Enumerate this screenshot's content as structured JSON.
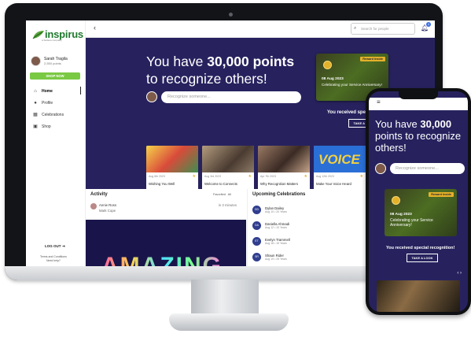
{
  "brand": {
    "name": "inspirus",
    "tagline": "a Sodexo company"
  },
  "user": {
    "name": "Sarah Tragila",
    "points": "2,550 points"
  },
  "sidebar": {
    "shop_button": "SHOP NOW",
    "items": [
      {
        "label": "Home",
        "icon": "home-icon"
      },
      {
        "label": "Profile",
        "icon": "person-icon"
      },
      {
        "label": "Celebrations",
        "icon": "calendar-icon"
      },
      {
        "label": "Shop",
        "icon": "bag-icon"
      }
    ],
    "logout": "LOG OUT",
    "terms": "Terms and Conditions",
    "help": "Need help?"
  },
  "topbar": {
    "search_placeholder": "Search for people",
    "notifications": "4"
  },
  "hero": {
    "title_prefix": "You have ",
    "points": "30,000 points",
    "title_suffix": "to recognize others!",
    "input_placeholder": "Recognize someone...",
    "award": {
      "tag": "Reward Inside",
      "date": "08 Aug 2023",
      "text": "Celebrating your Service Anniversary!"
    },
    "special_text": "You received special recognition!",
    "look_button": "TAKE A LOOK"
  },
  "cards": [
    {
      "date": "Aug 6th 2023",
      "title": "Wishing You Well",
      "color": "#e8c94b"
    },
    {
      "date": "Aug 3rd 2023",
      "title": "Welcome to Connects",
      "color": "#7b6a5a"
    },
    {
      "date": "Apr 7th 2023",
      "title": "Why Recognition Matters",
      "color": "#6e5448"
    },
    {
      "date": "Aug 12th 2023",
      "title": "Make Your Voice Heard",
      "color": "#2a6fd6",
      "image_text": "VOICE"
    }
  ],
  "activity": {
    "title": "Activity",
    "filters": [
      "Favorited",
      "All"
    ],
    "post": {
      "author": "Annie Ross",
      "to": "Mark Cope",
      "time": "in 3 minutes"
    },
    "image_text": "AMAZING"
  },
  "upcoming": {
    "title": "Upcoming Celebrations",
    "items": [
      {
        "initials": "DD",
        "name": "Dylan Dailey",
        "sub": "Aug 10 • 20 Years"
      },
      {
        "initials": "DA",
        "name": "Daniella Ahmadi",
        "sub": "Aug 12 • 10 Years"
      },
      {
        "initials": "ET",
        "name": "Evelyn Trammell",
        "sub": "Aug 18 • 15 Years"
      },
      {
        "initials": "SR",
        "name": "Shaun Rider",
        "sub": "Aug 19 • 25 Years"
      }
    ]
  },
  "phone": {
    "title_prefix": "You have ",
    "points": "30,000",
    "title_suffix": "points to recognize others!",
    "input_placeholder": "Recognize someone...",
    "award": {
      "tag": "Reward Inside",
      "date": "08 Aug 2023",
      "text": "Celebrating your Service Anniversary!"
    },
    "special_text": "You received special recognition!",
    "look_button": "TAKE A LOOK"
  },
  "colors": {
    "navy": "#27225e",
    "green": "#7ac943",
    "gold": "#e4b12a"
  }
}
